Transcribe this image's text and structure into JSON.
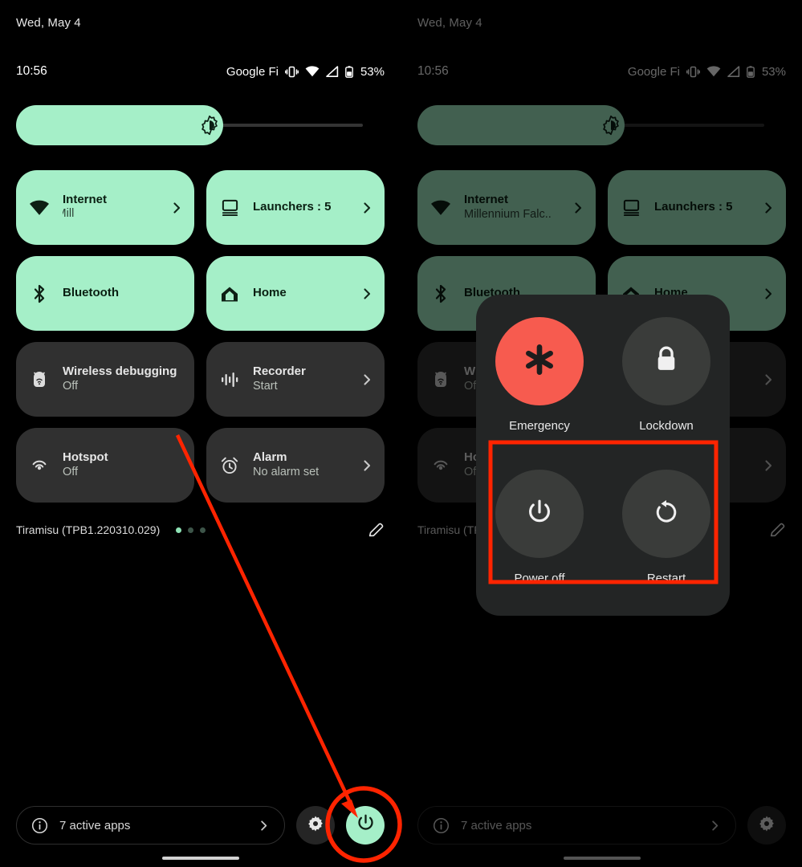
{
  "statusbar": {
    "date": "Wed, May 4",
    "clock": "10:56",
    "carrier": "Google Fi",
    "battery_percent": "53%",
    "icons": [
      "vibrate-icon",
      "wifi-icon",
      "cell-signal-icon",
      "battery-icon"
    ]
  },
  "brightness": {
    "icon": "brightness-icon",
    "fill_percent": 57
  },
  "tiles": [
    {
      "name": "internet",
      "title": "Internet",
      "sub": "Millennium Falcon",
      "sub_left_visible": "Falcon          Mill",
      "sub_right_visible": "Millennium Falc..",
      "icon": "wifi-icon",
      "state": "on",
      "chevron": true
    },
    {
      "name": "launchers",
      "title": "Launchers : 5",
      "sub": "",
      "icon": "desktop-icon",
      "state": "on",
      "chevron": true
    },
    {
      "name": "bluetooth",
      "title": "Bluetooth",
      "sub": "",
      "icon": "bluetooth-icon",
      "state": "on",
      "chevron": false
    },
    {
      "name": "home",
      "title": "Home",
      "sub": "",
      "icon": "home-icon",
      "state": "on",
      "chevron": true
    },
    {
      "name": "wireless-debugging",
      "title": "Wireless debugging",
      "sub": "Off",
      "icon": "android-bug-icon",
      "state": "off",
      "chevron": false
    },
    {
      "name": "recorder",
      "title": "Recorder",
      "sub": "Start",
      "icon": "waveform-icon",
      "state": "off",
      "chevron": true
    },
    {
      "name": "hotspot",
      "title": "Hotspot",
      "sub": "Off",
      "icon": "hotspot-icon",
      "state": "off",
      "chevron": false
    },
    {
      "name": "alarm",
      "title": "Alarm",
      "sub": "No alarm set",
      "icon": "alarm-clock-icon",
      "state": "off",
      "chevron": true
    }
  ],
  "footer": {
    "build": "Tiramisu (TPB1.220310.029)",
    "page_dots": 3,
    "active_dot_index": 0,
    "edit_icon": "pencil-icon"
  },
  "bottom_bar": {
    "info_icon": "info-icon",
    "active_apps_label": "7 active apps",
    "chevron_icon": "chevron-right-icon",
    "settings_icon": "gear-icon",
    "power_icon": "power-icon"
  },
  "power_dialog": {
    "items": [
      {
        "name": "emergency",
        "label": "Emergency",
        "icon": "asterisk-icon",
        "accent": "#F75B4F"
      },
      {
        "name": "lockdown",
        "label": "Lockdown",
        "icon": "lock-icon",
        "accent": "#3a3c3a"
      },
      {
        "name": "power-off",
        "label": "Power off",
        "icon": "power-icon",
        "accent": "#3a3c3a"
      },
      {
        "name": "restart",
        "label": "Restart",
        "icon": "restart-icon",
        "accent": "#3a3c3a"
      }
    ]
  },
  "annotations": {
    "highlight_color": "#FF2400",
    "circle_target": "power-button",
    "rect_target": "power-off-and-restart-row"
  },
  "colors": {
    "tile_on": "#A5EFC8",
    "tile_off": "#303030",
    "background": "#000000",
    "dialog_bg": "#232525",
    "emergency": "#F75B4F"
  }
}
